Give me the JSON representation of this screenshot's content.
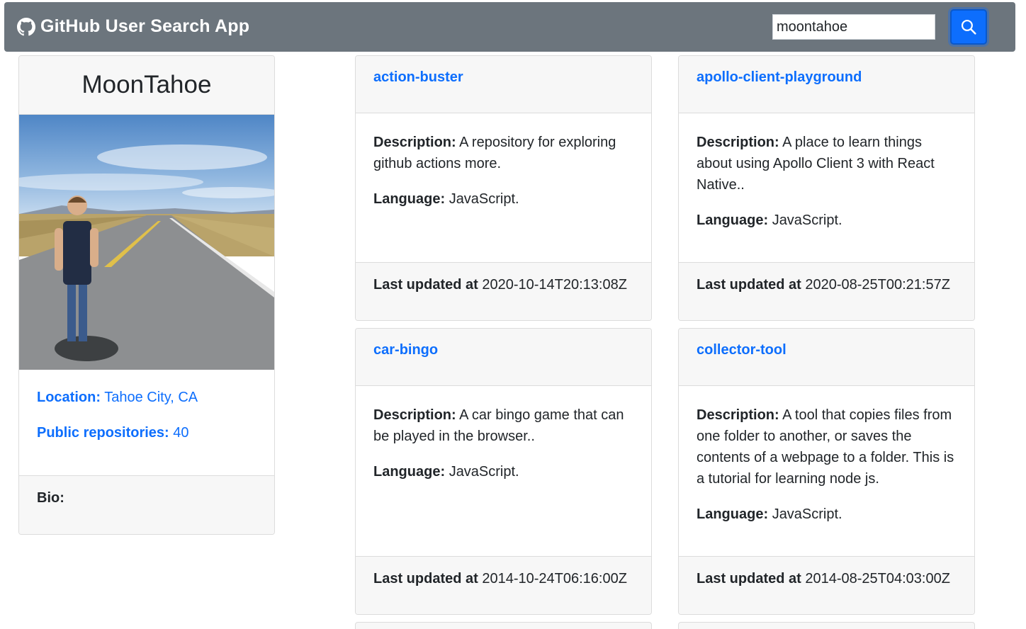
{
  "app": {
    "title": "GitHub User Search App"
  },
  "search": {
    "value": "moontahoe",
    "button_icon": "search-icon"
  },
  "colors": {
    "navbar": "#6c757d",
    "accent": "#0d6efd"
  },
  "user": {
    "name": "MoonTahoe",
    "location_label": "Location:",
    "location": "Tahoe City, CA",
    "repos_label": "Public repositories:",
    "repos_count": "40",
    "bio_label": "Bio:"
  },
  "labels": {
    "description": "Description:",
    "language": "Language:",
    "updated": "Last updated at"
  },
  "repos": [
    {
      "name": "action-buster",
      "description": "A repository for exploring github actions more.",
      "language": "JavaScript.",
      "updated": "2020-10-14T20:13:08Z"
    },
    {
      "name": "apollo-client-playground",
      "description": "A place to learn things about using Apollo Client 3 with React Native..",
      "language": "JavaScript.",
      "updated": "2020-08-25T00:21:57Z"
    },
    {
      "name": "car-bingo",
      "description": "A car bingo game that can be played in the browser..",
      "language": "JavaScript.",
      "updated": "2014-10-24T06:16:00Z"
    },
    {
      "name": "collector-tool",
      "description": "A tool that copies files from one folder to another, or saves the contents of a webpage to a folder. This is a tutorial for learning node js.",
      "language": "JavaScript.",
      "updated": "2014-08-25T04:03:00Z"
    }
  ]
}
